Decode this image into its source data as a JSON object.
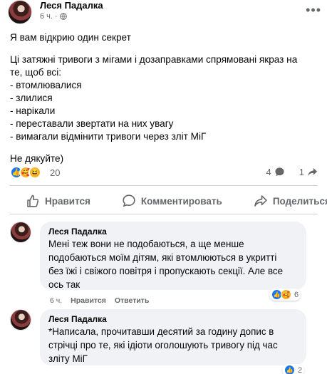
{
  "post": {
    "author": "Леся Падалка",
    "time": "6 ч.",
    "more_label": "•••",
    "body": {
      "line1": "Я вам відкрию один секрет",
      "para2": "Ці затяжні тривоги з мігами і дозаправками спрямовані якраз на\nте, щоб всі:\n- втомлювалися\n- злилися\n- нарікали\n- переставали звертати на них увагу\n- вимагали відмінити тривоги через зліт МіГ",
      "line3": "Не дякуйте)"
    },
    "reactions": {
      "icons": [
        "like-icon",
        "care-icon",
        "haha-icon"
      ],
      "count": "20",
      "comments_count": "4",
      "shares_count": "1"
    }
  },
  "actions": {
    "like_label": "Нравится",
    "comment_label": "Комментировать",
    "share_label": "Поделиться"
  },
  "comments": [
    {
      "author": "Леся Падалка",
      "text": "Мені теж вони не подобаються, а ще менше\nподобаються моїм дітям, які втомлюються в укритті\nбез їжі і свіжого повітря і пропускають секції. Але все\nось так",
      "time": "6 ч.",
      "like_label": "Нравится",
      "reply_label": "Ответить",
      "reaction_count": "6",
      "reaction_icons": [
        "like-icon",
        "care-icon"
      ]
    },
    {
      "author": "Леся Падалка",
      "text": "*Написала, прочитавши десятий за годину допис в\nстрічці про те, які ідіоти оголошують тривогу під час\nзліту МіГ",
      "reaction_count": "2",
      "reaction_icons": [
        "like-icon"
      ]
    }
  ],
  "colors": {
    "accent": "#1877f2",
    "secondary_text": "#65676b",
    "bubble_bg": "#f0f2f5"
  }
}
